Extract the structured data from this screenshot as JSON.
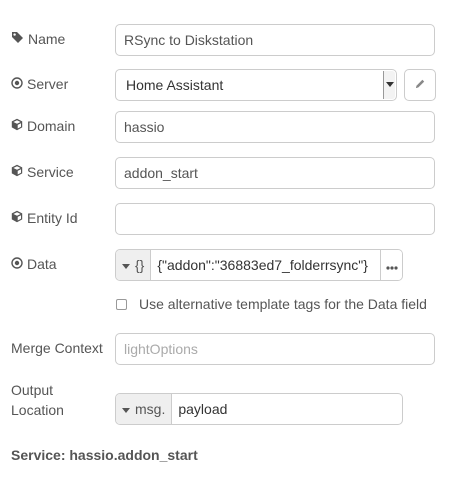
{
  "fields": {
    "name": {
      "label": "Name",
      "value": "RSync to Diskstation"
    },
    "server": {
      "label": "Server",
      "value": "Home Assistant"
    },
    "domain": {
      "label": "Domain",
      "value": "hassio"
    },
    "service": {
      "label": "Service",
      "value": "addon_start"
    },
    "entity_id": {
      "label": "Entity Id",
      "value": ""
    },
    "data": {
      "label": "Data",
      "type_label": "{}",
      "value": "{\"addon\":\"36883ed7_folderrsync\"}"
    },
    "alt_template": {
      "label": "Use alternative template tags for the Data field",
      "checked": false
    },
    "merge_context": {
      "label": "Merge Context",
      "value": "",
      "placeholder": "lightOptions"
    },
    "output_location": {
      "label_line1": "Output",
      "label_line2": "Location",
      "type_label": "msg.",
      "value": "payload"
    }
  },
  "status": {
    "text": "Service: hassio.addon_start"
  },
  "icons": {
    "name": "tag-icon",
    "server": "dot-circle-icon",
    "domain": "cube-icon",
    "service": "cube-icon",
    "entity_id": "cube-icon",
    "data": "dot-circle-icon",
    "edit": "pencil-icon"
  }
}
